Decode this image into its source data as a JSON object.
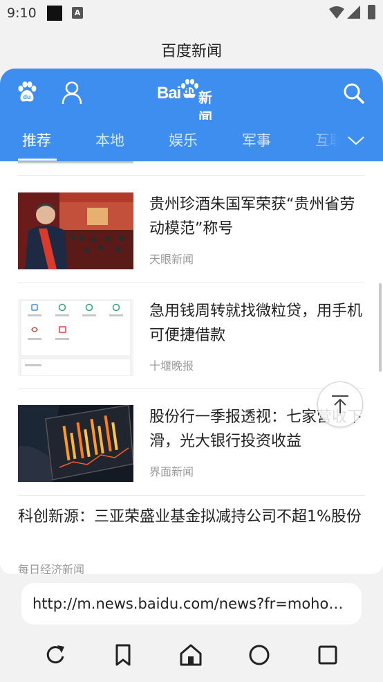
{
  "status_bar": {
    "time": "9:10",
    "notif_icon_letter": "A"
  },
  "window_title": "百度新闻",
  "header": {
    "logo_bai": "Bai",
    "logo_du": "du",
    "logo_news": "新闻",
    "brand_color": "#3e8ef0"
  },
  "tabs": [
    {
      "label": "推荐",
      "active": true
    },
    {
      "label": "本地"
    },
    {
      "label": "娱乐"
    },
    {
      "label": "军事"
    },
    {
      "label": "互联"
    }
  ],
  "news": [
    {
      "title": "贵州珍酒朱国军荣获“贵州省劳动模范”称号",
      "source": "天眼新闻",
      "thumb": "award-photo"
    },
    {
      "title": "急用钱周转就找微粒贷，用手机可便捷借款",
      "source": "十堰晚报",
      "thumb": "app-screenshot"
    },
    {
      "title": "股份行一季报透视：七家营收下滑，光大银行投资收益",
      "source": "界面新闻",
      "thumb": "tablet-chart"
    }
  ],
  "text_news": {
    "title": "科创新源：三亚荣盛业基金拟减持公司不超1%股份",
    "source": "每日经济新闻"
  },
  "url_bar": {
    "value": "http://m.news.baidu.com/news?fr=mohome"
  }
}
